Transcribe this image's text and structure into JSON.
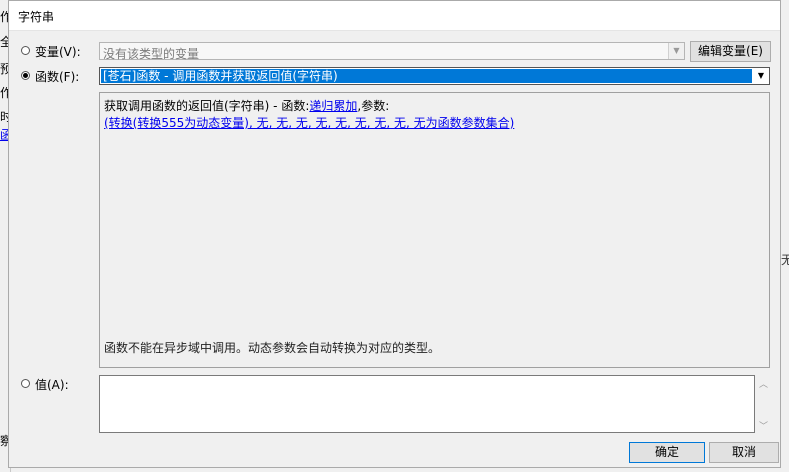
{
  "background": {
    "left_chars": [
      "作",
      "全",
      "预",
      "作",
      "时",
      "函",
      "察"
    ],
    "right_char": "无"
  },
  "dialog": {
    "title": "字符串",
    "variable": {
      "label": "变量(V):",
      "combo_text": "没有该类型的变量",
      "edit_button": "编辑变量(E)"
    },
    "function": {
      "label": "函数(F):",
      "combo_text": "[苍石]函数 - 调用函数并获取返回值(字符串)"
    },
    "panel": {
      "desc_prefix": "获取调用函数的返回值(字符串) - 函数:",
      "func_link": "递归累加",
      "desc_suffix": ",参数:",
      "args_link": "(转换(转换555为动态变量), 无, 无, 无, 无, 无, 无, 无, 无, 无为函数参数集合)",
      "note": "函数不能在异步域中调用。动态参数会自动转换为对应的类型。"
    },
    "value": {
      "label": "值(A):"
    },
    "ok_button": "确定",
    "cancel_button": "取消"
  }
}
